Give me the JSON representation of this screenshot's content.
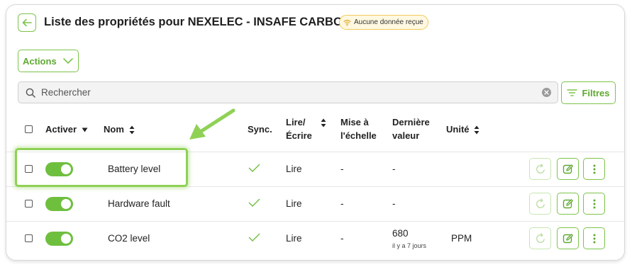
{
  "header": {
    "title": "Liste des propriétés pour NEXELEC - INSAFE CARBON",
    "status_badge": "Aucune donnée reçue"
  },
  "toolbar": {
    "actions_label": "Actions",
    "search_placeholder": "Rechercher",
    "filters_label": "Filtres"
  },
  "table": {
    "headers": {
      "activer": "Activer",
      "nom": "Nom",
      "sync": "Sync.",
      "lire_ecrire_1": "Lire/",
      "lire_ecrire_2": "Écrire",
      "mise_echelle_1": "Mise à",
      "mise_echelle_2": "l'échelle",
      "derniere_valeur_1": "Dernière",
      "derniere_valeur_2": "valeur",
      "unite": "Unité"
    },
    "rows": [
      {
        "enabled": true,
        "name": "Battery level",
        "sync": "✓",
        "rw": "Lire",
        "scale": "-",
        "last_value": "-",
        "last_value_time": "",
        "unit": ""
      },
      {
        "enabled": true,
        "name": "Hardware fault",
        "sync": "✓",
        "rw": "Lire",
        "scale": "-",
        "last_value": "-",
        "last_value_time": "",
        "unit": ""
      },
      {
        "enabled": true,
        "name": "CO2 level",
        "sync": "✓",
        "rw": "Lire",
        "scale": "-",
        "last_value": "680",
        "last_value_time": "il y a 7 jours",
        "unit": "PPM"
      }
    ]
  },
  "colors": {
    "accent": "#7cc44a",
    "accent_text": "#5ea832",
    "toggle_on": "#6fbf3f",
    "badge_border": "#f3c95a",
    "badge_bg": "#fff8e1",
    "highlight": "#8fd155"
  },
  "icons": [
    "back-arrow-icon",
    "wifi-icon",
    "chevron-down-icon",
    "search-icon",
    "clear-icon",
    "filter-icon",
    "sort-icon",
    "caret-down-icon",
    "checkmark-icon",
    "refresh-icon",
    "edit-icon",
    "more-vertical-icon"
  ]
}
